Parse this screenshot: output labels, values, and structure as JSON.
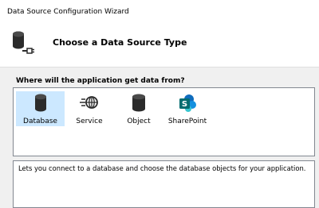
{
  "window": {
    "title": "Data Source Configuration Wizard"
  },
  "header": {
    "icon": "database-connector-icon",
    "heading": "Choose a Data Source Type"
  },
  "question": "Where will the application get data from?",
  "types": [
    {
      "label": "Database",
      "icon": "database-icon",
      "selected": true
    },
    {
      "label": "Service",
      "icon": "service-icon",
      "selected": false
    },
    {
      "label": "Object",
      "icon": "object-icon",
      "selected": false
    },
    {
      "label": "SharePoint",
      "icon": "sharepoint-icon",
      "selected": false
    }
  ],
  "description": "Lets you connect to a database and choose the database objects for your application.",
  "colors": {
    "selection": "#cce8ff",
    "border": "#828790",
    "sharepoint_blue": "#0f6cbd"
  }
}
